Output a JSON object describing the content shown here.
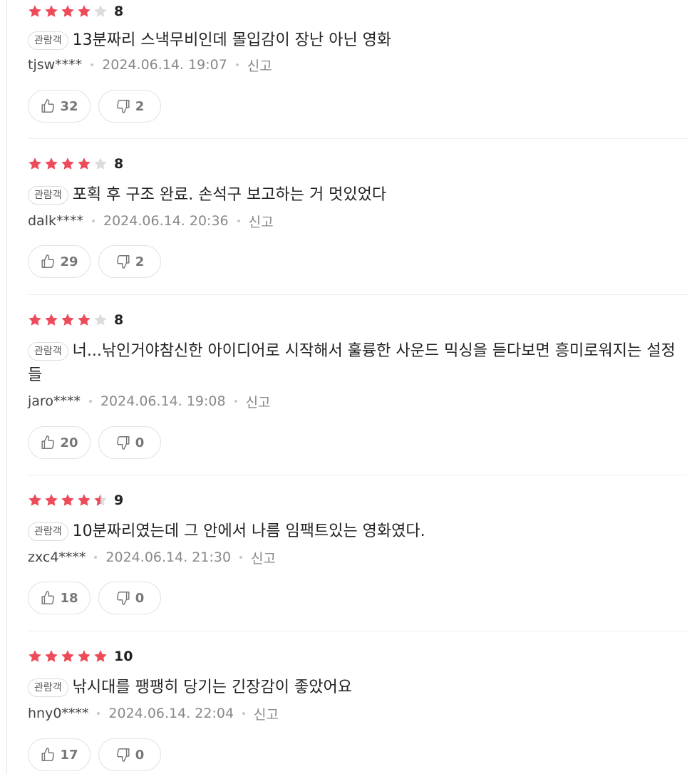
{
  "colors": {
    "star_filled": "#ef4a59",
    "star_empty": "#dcdcdc"
  },
  "reviews": [
    {
      "stars": [
        1,
        1,
        1,
        1,
        0
      ],
      "score": "8",
      "badge": "관람객",
      "text": "13분짜리 스낵무비인데 몰입감이 장난 아닌 영화",
      "user": "tjsw****",
      "date": "2024.06.14. 19:07",
      "report": "신고",
      "likes": "32",
      "dislikes": "2"
    },
    {
      "stars": [
        1,
        1,
        1,
        1,
        0
      ],
      "score": "8",
      "badge": "관람객",
      "text": "포획 후 구조 완료. 손석구 보고하는 거 멋있었다",
      "user": "dalk****",
      "date": "2024.06.14. 20:36",
      "report": "신고",
      "likes": "29",
      "dislikes": "2"
    },
    {
      "stars": [
        1,
        1,
        1,
        1,
        0
      ],
      "score": "8",
      "badge": "관람객",
      "text": "너...낚인거야참신한 아이디어로 시작해서 훌륭한 사운드 믹싱을 듣다보면 흥미로워지는 설정들",
      "user": "jaro****",
      "date": "2024.06.14. 19:08",
      "report": "신고",
      "likes": "20",
      "dislikes": "0"
    },
    {
      "stars": [
        1,
        1,
        1,
        1,
        0.5
      ],
      "score": "9",
      "badge": "관람객",
      "text": "10분짜리였는데 그 안에서 나름 임팩트있는 영화였다.",
      "user": "zxc4****",
      "date": "2024.06.14. 21:30",
      "report": "신고",
      "likes": "18",
      "dislikes": "0"
    },
    {
      "stars": [
        1,
        1,
        1,
        1,
        1
      ],
      "score": "10",
      "badge": "관람객",
      "text": "낚시대를 팽팽히 당기는 긴장감이 좋았어요",
      "user": "hny0****",
      "date": "2024.06.14. 22:04",
      "report": "신고",
      "likes": "17",
      "dislikes": "0"
    }
  ]
}
